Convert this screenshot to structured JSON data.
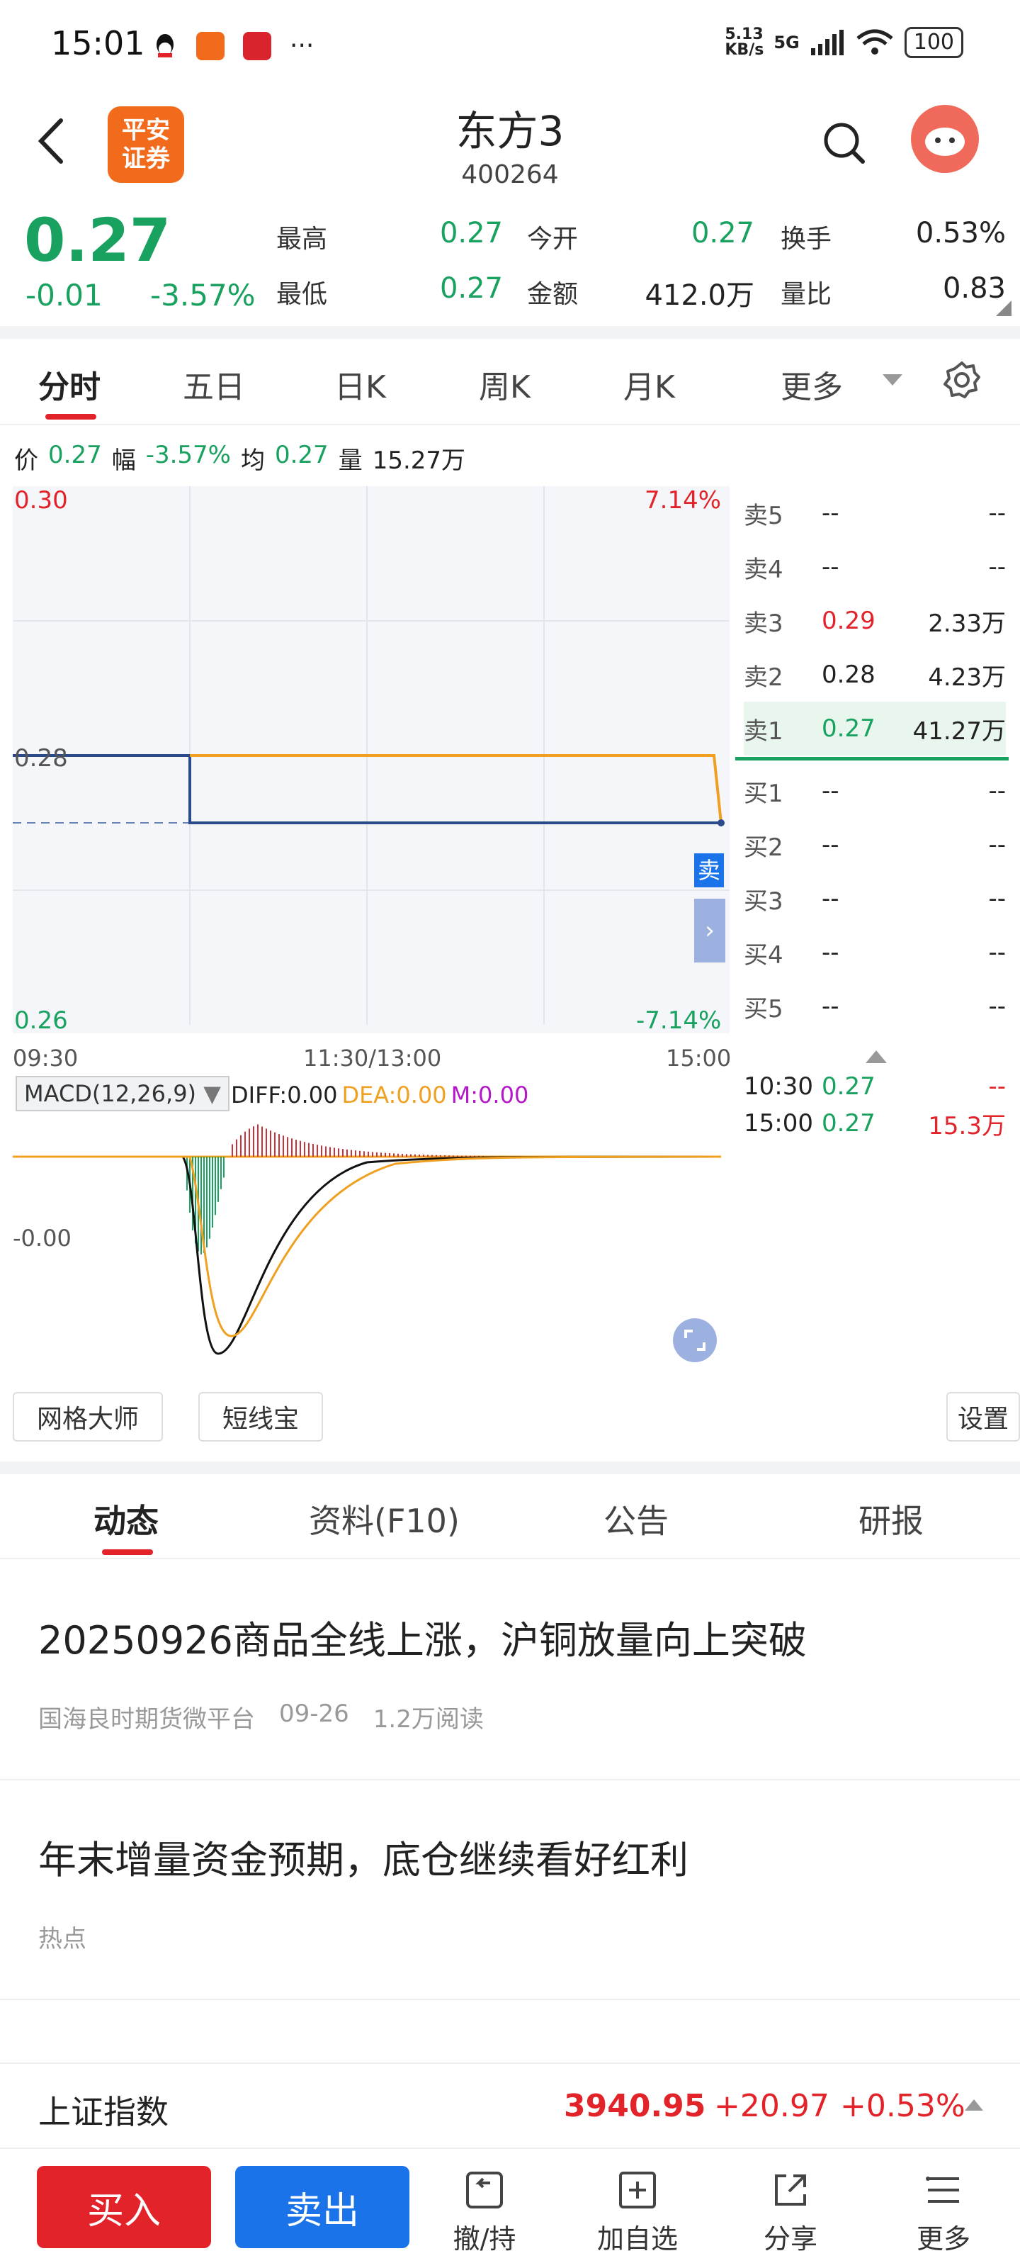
{
  "status": {
    "time": "15:01",
    "net_speed": "5.13\nKB/s",
    "signal": "5G",
    "battery": "100",
    "more": "···"
  },
  "header": {
    "logo_text_1": "平安",
    "logo_text_2": "证券",
    "title": "东方3",
    "code": "400264"
  },
  "quote": {
    "price": "0.27",
    "change": "-0.01",
    "change_pct": "-3.57%",
    "stats": [
      {
        "label": "最高",
        "value": "0.27",
        "color": "#19a15f"
      },
      {
        "label": "今开",
        "value": "0.27",
        "color": "#19a15f"
      },
      {
        "label": "换手",
        "value": "0.53%",
        "color": "#222222"
      },
      {
        "label": "最低",
        "value": "0.27",
        "color": "#19a15f"
      },
      {
        "label": "金额",
        "value": "412.0万",
        "color": "#222222"
      },
      {
        "label": "量比",
        "value": "0.83",
        "color": "#222222"
      }
    ]
  },
  "chart_tabs": [
    "分时",
    "五日",
    "日K",
    "周K",
    "月K",
    "更多"
  ],
  "info_line": {
    "price_label": "价",
    "price": "0.27",
    "amp_label": "幅",
    "amp": "-3.57%",
    "avg_label": "均",
    "avg": "0.27",
    "vol_label": "量",
    "vol": "15.27万"
  },
  "chart_data": {
    "type": "line",
    "x_ticks": [
      "09:30",
      "11:30/13:00",
      "15:00"
    ],
    "y_left_ticks": [
      "0.30",
      "0.28",
      "0.26"
    ],
    "y_right_ticks": [
      "7.14%",
      "-7.14%"
    ],
    "ylim": [
      0.26,
      0.3
    ],
    "prev_close": 0.28,
    "series": [
      {
        "values": [
          [
            0,
            0.28
          ],
          [
            0.25,
            0.28
          ],
          [
            0.25,
            0.275
          ],
          [
            1,
            0.275
          ]
        ],
        "color": "#2b4a8a"
      },
      {
        "values": [
          [
            0.25,
            0.28
          ],
          [
            0.99,
            0.28
          ],
          [
            1,
            0.275
          ]
        ],
        "color": "#f0a020"
      }
    ],
    "sell_marker": "卖"
  },
  "order_book": {
    "asks": [
      {
        "label": "卖5",
        "price": "--",
        "vol": "--",
        "price_color": "#222222"
      },
      {
        "label": "卖4",
        "price": "--",
        "vol": "--",
        "price_color": "#222222"
      },
      {
        "label": "卖3",
        "price": "0.29",
        "vol": "2.33万",
        "price_color": "#e2232a"
      },
      {
        "label": "卖2",
        "price": "0.28",
        "vol": "4.23万",
        "price_color": "#222222"
      },
      {
        "label": "卖1",
        "price": "0.27",
        "vol": "41.27万",
        "price_color": "#19a15f"
      }
    ],
    "bids": [
      {
        "label": "买1",
        "price": "--",
        "vol": "--"
      },
      {
        "label": "买2",
        "price": "--",
        "vol": "--"
      },
      {
        "label": "买3",
        "price": "--",
        "vol": "--"
      },
      {
        "label": "买4",
        "price": "--",
        "vol": "--"
      },
      {
        "label": "买5",
        "price": "--",
        "vol": "--"
      }
    ],
    "ticks": [
      {
        "time": "10:30",
        "price": "0.27",
        "vol": "--"
      },
      {
        "time": "15:00",
        "price": "0.27",
        "vol": "15.3万"
      }
    ]
  },
  "macd": {
    "label": "MACD(12,26,9)",
    "diff": "DIFF:0.00",
    "dea": "DEA:0.00",
    "m": "M:0.00",
    "y_tick": "-0.00"
  },
  "tools": {
    "grid_master": "网格大师",
    "short_line": "短线宝",
    "settings": "设置"
  },
  "news_tabs": [
    "动态",
    "资料(F10)",
    "公告",
    "研报"
  ],
  "news": [
    {
      "title": "20250926商品全线上涨，沪铜放量向上突破",
      "source": "国海良时期货微平台",
      "date": "09-26",
      "reads": "1.2万阅读"
    },
    {
      "title": "年末增量资金预期，底仓继续看好红利",
      "source": "热点",
      "date": "",
      "reads": ""
    }
  ],
  "index": {
    "name": "上证指数",
    "value": "3940.95",
    "change": "+20.97",
    "pct": "+0.53%"
  },
  "bottom_nav": {
    "buy": "买入",
    "sell": "卖出",
    "items": [
      "撤/持",
      "加自选",
      "分享",
      "更多"
    ]
  }
}
